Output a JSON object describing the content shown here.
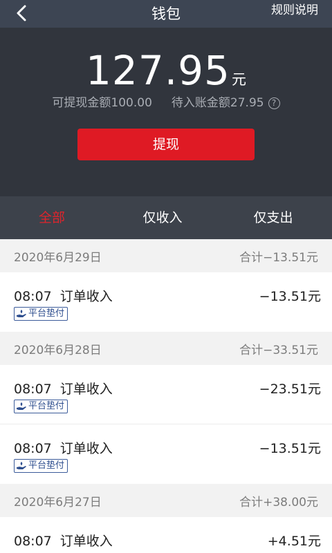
{
  "header": {
    "title": "钱包",
    "rules_label": "规则说明"
  },
  "wallet": {
    "balance": "127.95",
    "unit": "元",
    "withdrawable_label": "可提现金额100.00",
    "pending_label": "待入账金额27.95",
    "withdraw_button": "提现"
  },
  "tabs": [
    {
      "label": "全部",
      "active": true
    },
    {
      "label": "仅收入",
      "active": false
    },
    {
      "label": "仅支出",
      "active": false
    }
  ],
  "groups": [
    {
      "date": "2020年6月29日",
      "total": "合计−13.51元",
      "records": [
        {
          "time": "08:07",
          "type": "订单收入",
          "amount": "−13.51元",
          "badge": "平台垫付"
        }
      ]
    },
    {
      "date": "2020年6月28日",
      "total": "合计−33.51元",
      "records": [
        {
          "time": "08:07",
          "type": "订单收入",
          "amount": "−23.51元",
          "badge": "平台垫付"
        },
        {
          "time": "08:07",
          "type": "订单收入",
          "amount": "−13.51元",
          "badge": "平台垫付"
        }
      ]
    },
    {
      "date": "2020年6月27日",
      "total": "合计+38.00元",
      "records": [
        {
          "time": "08:07",
          "type": "订单收入",
          "amount": "+4.51元",
          "badge": ""
        }
      ]
    }
  ],
  "colors": {
    "nav_bg": "#3d4553",
    "wallet_bg": "#31353d",
    "tabs_bg": "#3d424b",
    "accent_red": "#df1a24",
    "badge_blue": "#2f4f8f"
  },
  "icons": {
    "back": "chevron-left-icon",
    "help": "question-circle-icon",
    "badge": "hand-coin-icon"
  }
}
